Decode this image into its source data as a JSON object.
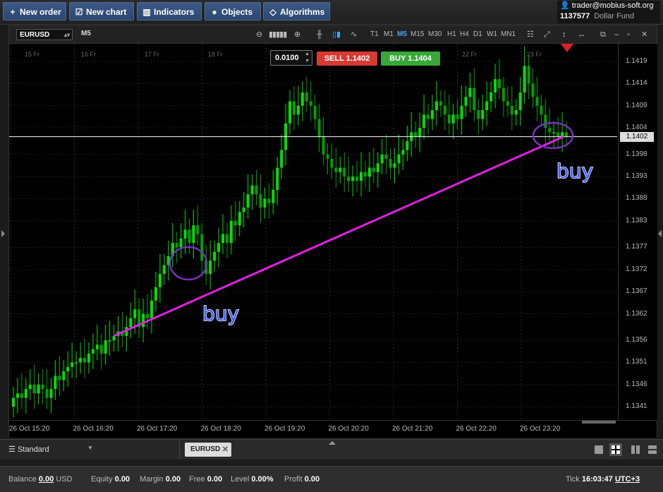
{
  "toolbar": {
    "new_order": "New order",
    "new_chart": "New chart",
    "indicators": "Indicators",
    "objects": "Objects",
    "algorithms": "Algorithms"
  },
  "account": {
    "user": "trader@mobius-soft.org",
    "number": "1137577",
    "fund": "Dollar Fund"
  },
  "chart": {
    "symbol": "EURUSD",
    "timeframe": "M5",
    "timeframes": [
      "T1",
      "M1",
      "M5",
      "M15",
      "M30",
      "H1",
      "H4",
      "D1",
      "W1",
      "MN1"
    ],
    "active_timeframe": "M5",
    "lot": "0.0100",
    "sell_label": "SELL 1.1402",
    "buy_label": "BUY 1.1404",
    "current_price": "1.1402",
    "date_labels": [
      "15 Fr",
      "16 Fr",
      "17 Fr",
      "18 Fr",
      "22 Fr",
      "23 Fr"
    ],
    "annotation_1": "buy",
    "annotation_2": "buy"
  },
  "chart_data": {
    "type": "candlestick",
    "price_ticks": [
      "1.1419",
      "1.1414",
      "1.1409",
      "1.1404",
      "1.1398",
      "1.1393",
      "1.1388",
      "1.1383",
      "1.1377",
      "1.1372",
      "1.1367",
      "1.1362",
      "1.1356",
      "1.1351",
      "1.1346",
      "1.1341"
    ],
    "time_ticks": [
      "26 Oct 15:20",
      "26 Oct 16:20",
      "26 Oct 17:20",
      "26 Oct 18:20",
      "26 Oct 19:20",
      "26 Oct 20:20",
      "26 Oct 21:20",
      "26 Oct 22:20",
      "26 Oct 23:20"
    ],
    "ylim": [
      1.1338,
      1.1423
    ],
    "current_price": 1.1402,
    "trendline": {
      "from": [
        "26 Oct 16:20",
        1.1357
      ],
      "to": [
        "26 Oct 23:55",
        1.1402
      ]
    },
    "closes": [
      1.1343,
      1.1344,
      1.1343,
      1.1345,
      1.1346,
      1.1344,
      1.1346,
      1.1345,
      1.1343,
      1.1345,
      1.1348,
      1.1347,
      1.1349,
      1.135,
      1.1351,
      1.1351,
      1.1352,
      1.1351,
      1.1353,
      1.1354,
      1.1355,
      1.1353,
      1.1356,
      1.1356,
      1.1357,
      1.1358,
      1.1357,
      1.1359,
      1.1361,
      1.1363,
      1.1359,
      1.1362,
      1.1361,
      1.1365,
      1.1368,
      1.1371,
      1.1373,
      1.1375,
      1.1378,
      1.1377,
      1.1379,
      1.1381,
      1.1378,
      1.1382,
      1.138,
      1.1374,
      1.1371,
      1.1374,
      1.1376,
      1.1378,
      1.138,
      1.1378,
      1.1383,
      1.1382,
      1.1385,
      1.1386,
      1.1389,
      1.1391,
      1.1389,
      1.1386,
      1.1388,
      1.1387,
      1.139,
      1.1395,
      1.1399,
      1.1405,
      1.141,
      1.1407,
      1.1409,
      1.1412,
      1.141,
      1.1409,
      1.1406,
      1.1402,
      1.1398,
      1.1397,
      1.1395,
      1.1394,
      1.1395,
      1.1393,
      1.1392,
      1.1393,
      1.1392,
      1.1394,
      1.1393,
      1.1395,
      1.1394,
      1.1396,
      1.1398,
      1.1397,
      1.1395,
      1.1396,
      1.1398,
      1.1399,
      1.1401,
      1.1403,
      1.1402,
      1.1404,
      1.1407,
      1.1406,
      1.1408,
      1.141,
      1.1409,
      1.1407,
      1.1405,
      1.1407,
      1.1406,
      1.1409,
      1.1411,
      1.1413,
      1.1408,
      1.1406,
      1.1408,
      1.141,
      1.1412,
      1.1415,
      1.1413,
      1.141,
      1.1409,
      1.1407,
      1.1408,
      1.1412,
      1.1418,
      1.1414,
      1.1411,
      1.1409,
      1.1407,
      1.1404,
      1.1403,
      1.1403,
      1.1402,
      1.1403,
      1.1402
    ]
  },
  "tabs": {
    "workspace": "Standard",
    "chart_tab": "EURUSD"
  },
  "status": {
    "balance_label": "Balance",
    "balance_value": "0.00",
    "balance_currency": "USD",
    "equity_label": "Equity",
    "equity_value": "0.00",
    "margin_label": "Margin",
    "margin_value": "0.00",
    "free_label": "Free",
    "free_value": "0.00",
    "level_label": "Level",
    "level_value": "0.00%",
    "profit_label": "Profit",
    "profit_value": "0.00",
    "tick_label": "Tick",
    "tick_value": "16:03:47",
    "timezone": "UTC+3"
  },
  "colors": {
    "candle_up": "#00e000",
    "candle_down": "#00a000",
    "trendline": "#e020e0",
    "circle": "#7a2fc2",
    "annotation": "#3d5cff",
    "sell": "#d83a33",
    "buy": "#38a838"
  }
}
